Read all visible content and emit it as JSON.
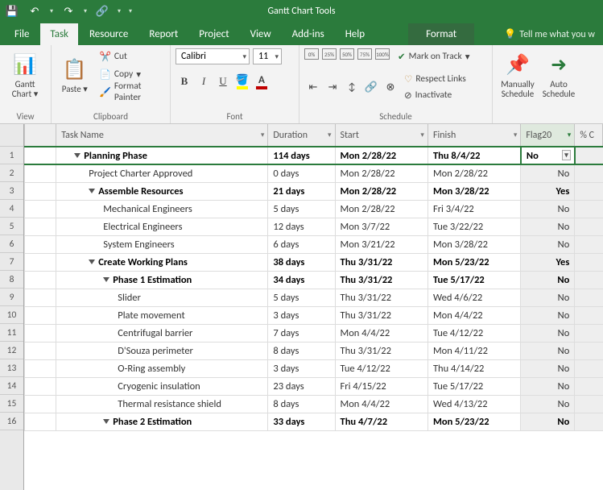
{
  "qat": {
    "save": "💾",
    "undo": "↶",
    "redo": "↷"
  },
  "title_context": "Gantt Chart Tools",
  "tabs": {
    "file": "File",
    "task": "Task",
    "resource": "Resource",
    "report": "Report",
    "project": "Project",
    "view": "View",
    "addins": "Add-ins",
    "help": "Help",
    "format": "Format"
  },
  "tellme": "Tell me what you w",
  "ribbon": {
    "view": {
      "gantt_chart": "Gantt Chart",
      "label": "View"
    },
    "clipboard": {
      "paste": "Paste",
      "cut": "Cut",
      "copy": "Copy",
      "format_painter": "Format Painter",
      "label": "Clipboard"
    },
    "font": {
      "name": "Calibri",
      "size": "11",
      "label": "Font"
    },
    "schedule": {
      "mark_on_track": "Mark on Track",
      "respect_links": "Respect Links",
      "inactivate": "Inactivate",
      "label": "Schedule"
    },
    "tasks": {
      "manually": "Manually Schedule",
      "auto": "Auto Schedule"
    }
  },
  "columns": {
    "task_name": "Task Name",
    "duration": "Duration",
    "start": "Start",
    "finish": "Finish",
    "flag20": "Flag20",
    "pct": "% C"
  },
  "rows": [
    {
      "n": 1,
      "lvl": 0,
      "sum": true,
      "name": "Planning Phase",
      "dur": "114 days",
      "start": "Mon 2/28/22",
      "finish": "Thu 8/4/22",
      "flag": "No"
    },
    {
      "n": 2,
      "lvl": 1,
      "sum": false,
      "name": "Project Charter Approved",
      "dur": "0 days",
      "start": "Mon 2/28/22",
      "finish": "Mon 2/28/22",
      "flag": "No"
    },
    {
      "n": 3,
      "lvl": 1,
      "sum": true,
      "name": "Assemble Resources",
      "dur": "21 days",
      "start": "Mon 2/28/22",
      "finish": "Mon 3/28/22",
      "flag": "Yes"
    },
    {
      "n": 4,
      "lvl": 2,
      "sum": false,
      "name": "Mechanical Engineers",
      "dur": "5 days",
      "start": "Mon 2/28/22",
      "finish": "Fri 3/4/22",
      "flag": "No"
    },
    {
      "n": 5,
      "lvl": 2,
      "sum": false,
      "name": "Electrical Engineers",
      "dur": "12 days",
      "start": "Mon 3/7/22",
      "finish": "Tue 3/22/22",
      "flag": "No"
    },
    {
      "n": 6,
      "lvl": 2,
      "sum": false,
      "name": "System Engineers",
      "dur": "6 days",
      "start": "Mon 3/21/22",
      "finish": "Mon 3/28/22",
      "flag": "No"
    },
    {
      "n": 7,
      "lvl": 1,
      "sum": true,
      "name": "Create Working Plans",
      "dur": "38 days",
      "start": "Thu 3/31/22",
      "finish": "Mon 5/23/22",
      "flag": "Yes"
    },
    {
      "n": 8,
      "lvl": 2,
      "sum": true,
      "name": "Phase 1 Estimation",
      "dur": "34 days",
      "start": "Thu 3/31/22",
      "finish": "Tue 5/17/22",
      "flag": "No"
    },
    {
      "n": 9,
      "lvl": 3,
      "sum": false,
      "name": "Slider",
      "dur": "5 days",
      "start": "Thu 3/31/22",
      "finish": "Wed 4/6/22",
      "flag": "No"
    },
    {
      "n": 10,
      "lvl": 3,
      "sum": false,
      "name": "Plate movement",
      "dur": "3 days",
      "start": "Thu 3/31/22",
      "finish": "Mon 4/4/22",
      "flag": "No"
    },
    {
      "n": 11,
      "lvl": 3,
      "sum": false,
      "name": "Centrifugal barrier",
      "dur": "7 days",
      "start": "Mon 4/4/22",
      "finish": "Tue 4/12/22",
      "flag": "No"
    },
    {
      "n": 12,
      "lvl": 3,
      "sum": false,
      "name": "D'Souza perimeter",
      "dur": "8 days",
      "start": "Thu 3/31/22",
      "finish": "Mon 4/11/22",
      "flag": "No"
    },
    {
      "n": 13,
      "lvl": 3,
      "sum": false,
      "name": "O-Ring assembly",
      "dur": "3 days",
      "start": "Tue 4/12/22",
      "finish": "Thu 4/14/22",
      "flag": "No"
    },
    {
      "n": 14,
      "lvl": 3,
      "sum": false,
      "name": "Cryogenic insulation",
      "dur": "23 days",
      "start": "Fri 4/15/22",
      "finish": "Tue 5/17/22",
      "flag": "No"
    },
    {
      "n": 15,
      "lvl": 3,
      "sum": false,
      "name": "Thermal resistance shield",
      "dur": "8 days",
      "start": "Mon 4/4/22",
      "finish": "Wed 4/13/22",
      "flag": "No"
    },
    {
      "n": 16,
      "lvl": 2,
      "sum": true,
      "name": "Phase 2 Estimation",
      "dur": "33 days",
      "start": "Thu 4/7/22",
      "finish": "Mon 5/23/22",
      "flag": "No"
    }
  ]
}
